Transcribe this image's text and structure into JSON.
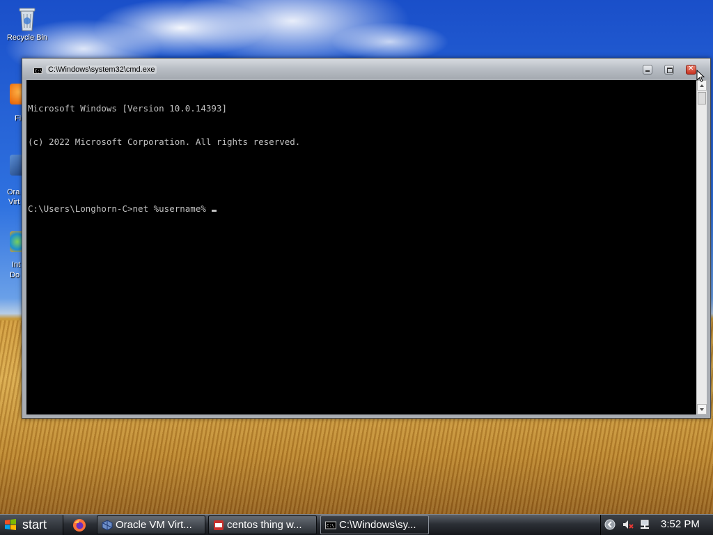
{
  "desktop": {
    "icons": [
      {
        "label": "Recycle Bin",
        "icon": "recycle-bin-icon"
      }
    ],
    "partial_labels": [
      "Fi",
      "Ora",
      "Virt",
      "Int",
      "Do"
    ]
  },
  "window": {
    "title": "C:\\Windows\\system32\\cmd.exe",
    "console_lines": [
      "Microsoft Windows [Version 10.0.14393]",
      "(c) 2022 Microsoft Corporation. All rights reserved.",
      "",
      "C:\\Users\\Longhorn-C>net %username%"
    ]
  },
  "taskbar": {
    "start_label": "start",
    "quick_launch": [
      {
        "icon": "firefox-icon"
      }
    ],
    "tasks": [
      {
        "label": "Oracle VM Virt...",
        "icon": "virtualbox-icon",
        "active": false
      },
      {
        "label": "centos thing w...",
        "icon": "document-icon",
        "active": false
      },
      {
        "label": "C:\\Windows\\sy...",
        "icon": "cmd-icon",
        "active": true
      }
    ],
    "tray": {
      "icons": [
        "back-arrow-icon",
        "volume-muted-icon",
        "network-icon"
      ],
      "clock": "3:52 PM"
    }
  },
  "colors": {
    "console_bg": "#000000",
    "console_fg": "#c0c0c0",
    "taskbar_bg": "#2c3036"
  }
}
